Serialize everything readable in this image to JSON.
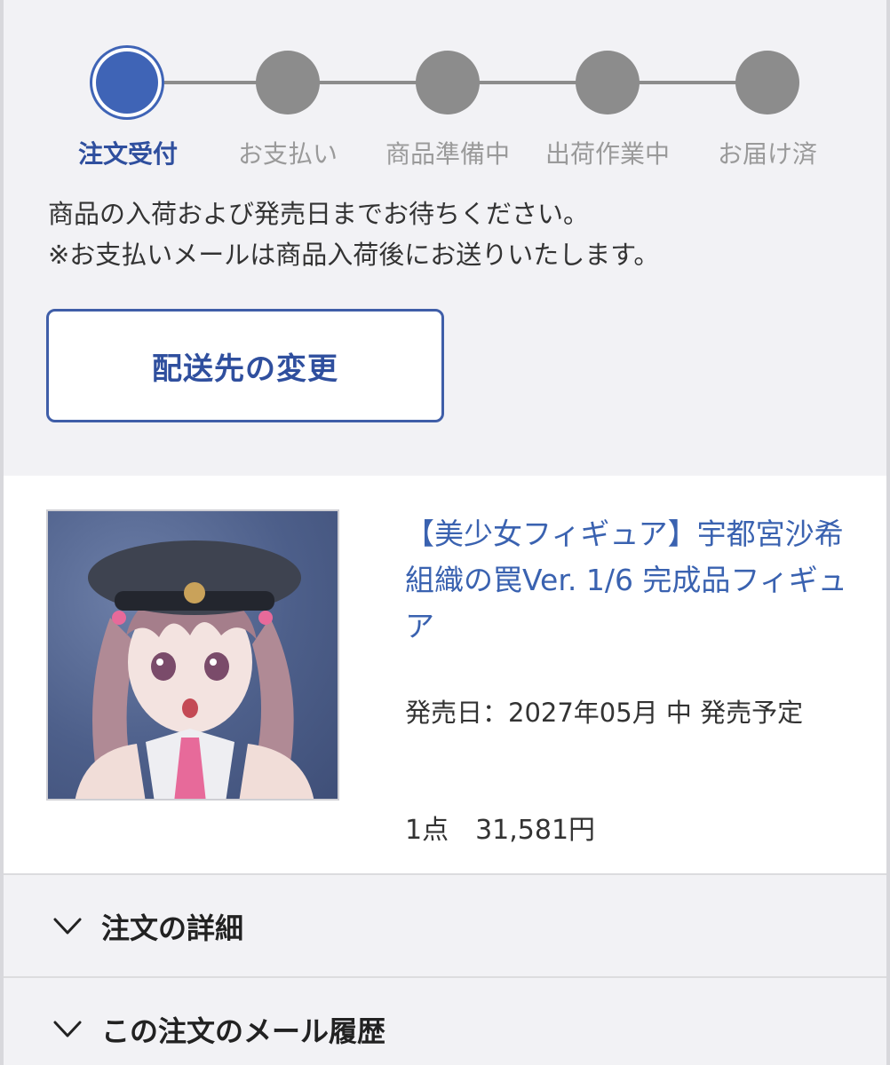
{
  "steps": [
    {
      "label": "注文受付",
      "active": true
    },
    {
      "label": "お支払い",
      "active": false
    },
    {
      "label": "商品準備中",
      "active": false
    },
    {
      "label": "出荷作業中",
      "active": false
    },
    {
      "label": "お届け済",
      "active": false
    }
  ],
  "notice": {
    "line1": "商品の入荷および発売日までお待ちください。",
    "line2": "※お支払いメールは商品入荷後にお送りいたします。"
  },
  "change_address_button": "配送先の変更",
  "product": {
    "title": "【美少女フィギュア】宇都宮沙希 組織の罠Ver. 1/6 完成品フィギュア",
    "release": "発売日：2027年05月 中 発売予定",
    "quantity_price": "1点　31,581円"
  },
  "accordions": {
    "order_details": "注文の詳細",
    "mail_history": "この注文のメール履歴"
  },
  "colors": {
    "accent": "#3f64b6",
    "inactive": "#8c8c8c",
    "link": "#3a62b0"
  },
  "icons": {
    "accordion": "chevron-down-icon"
  }
}
